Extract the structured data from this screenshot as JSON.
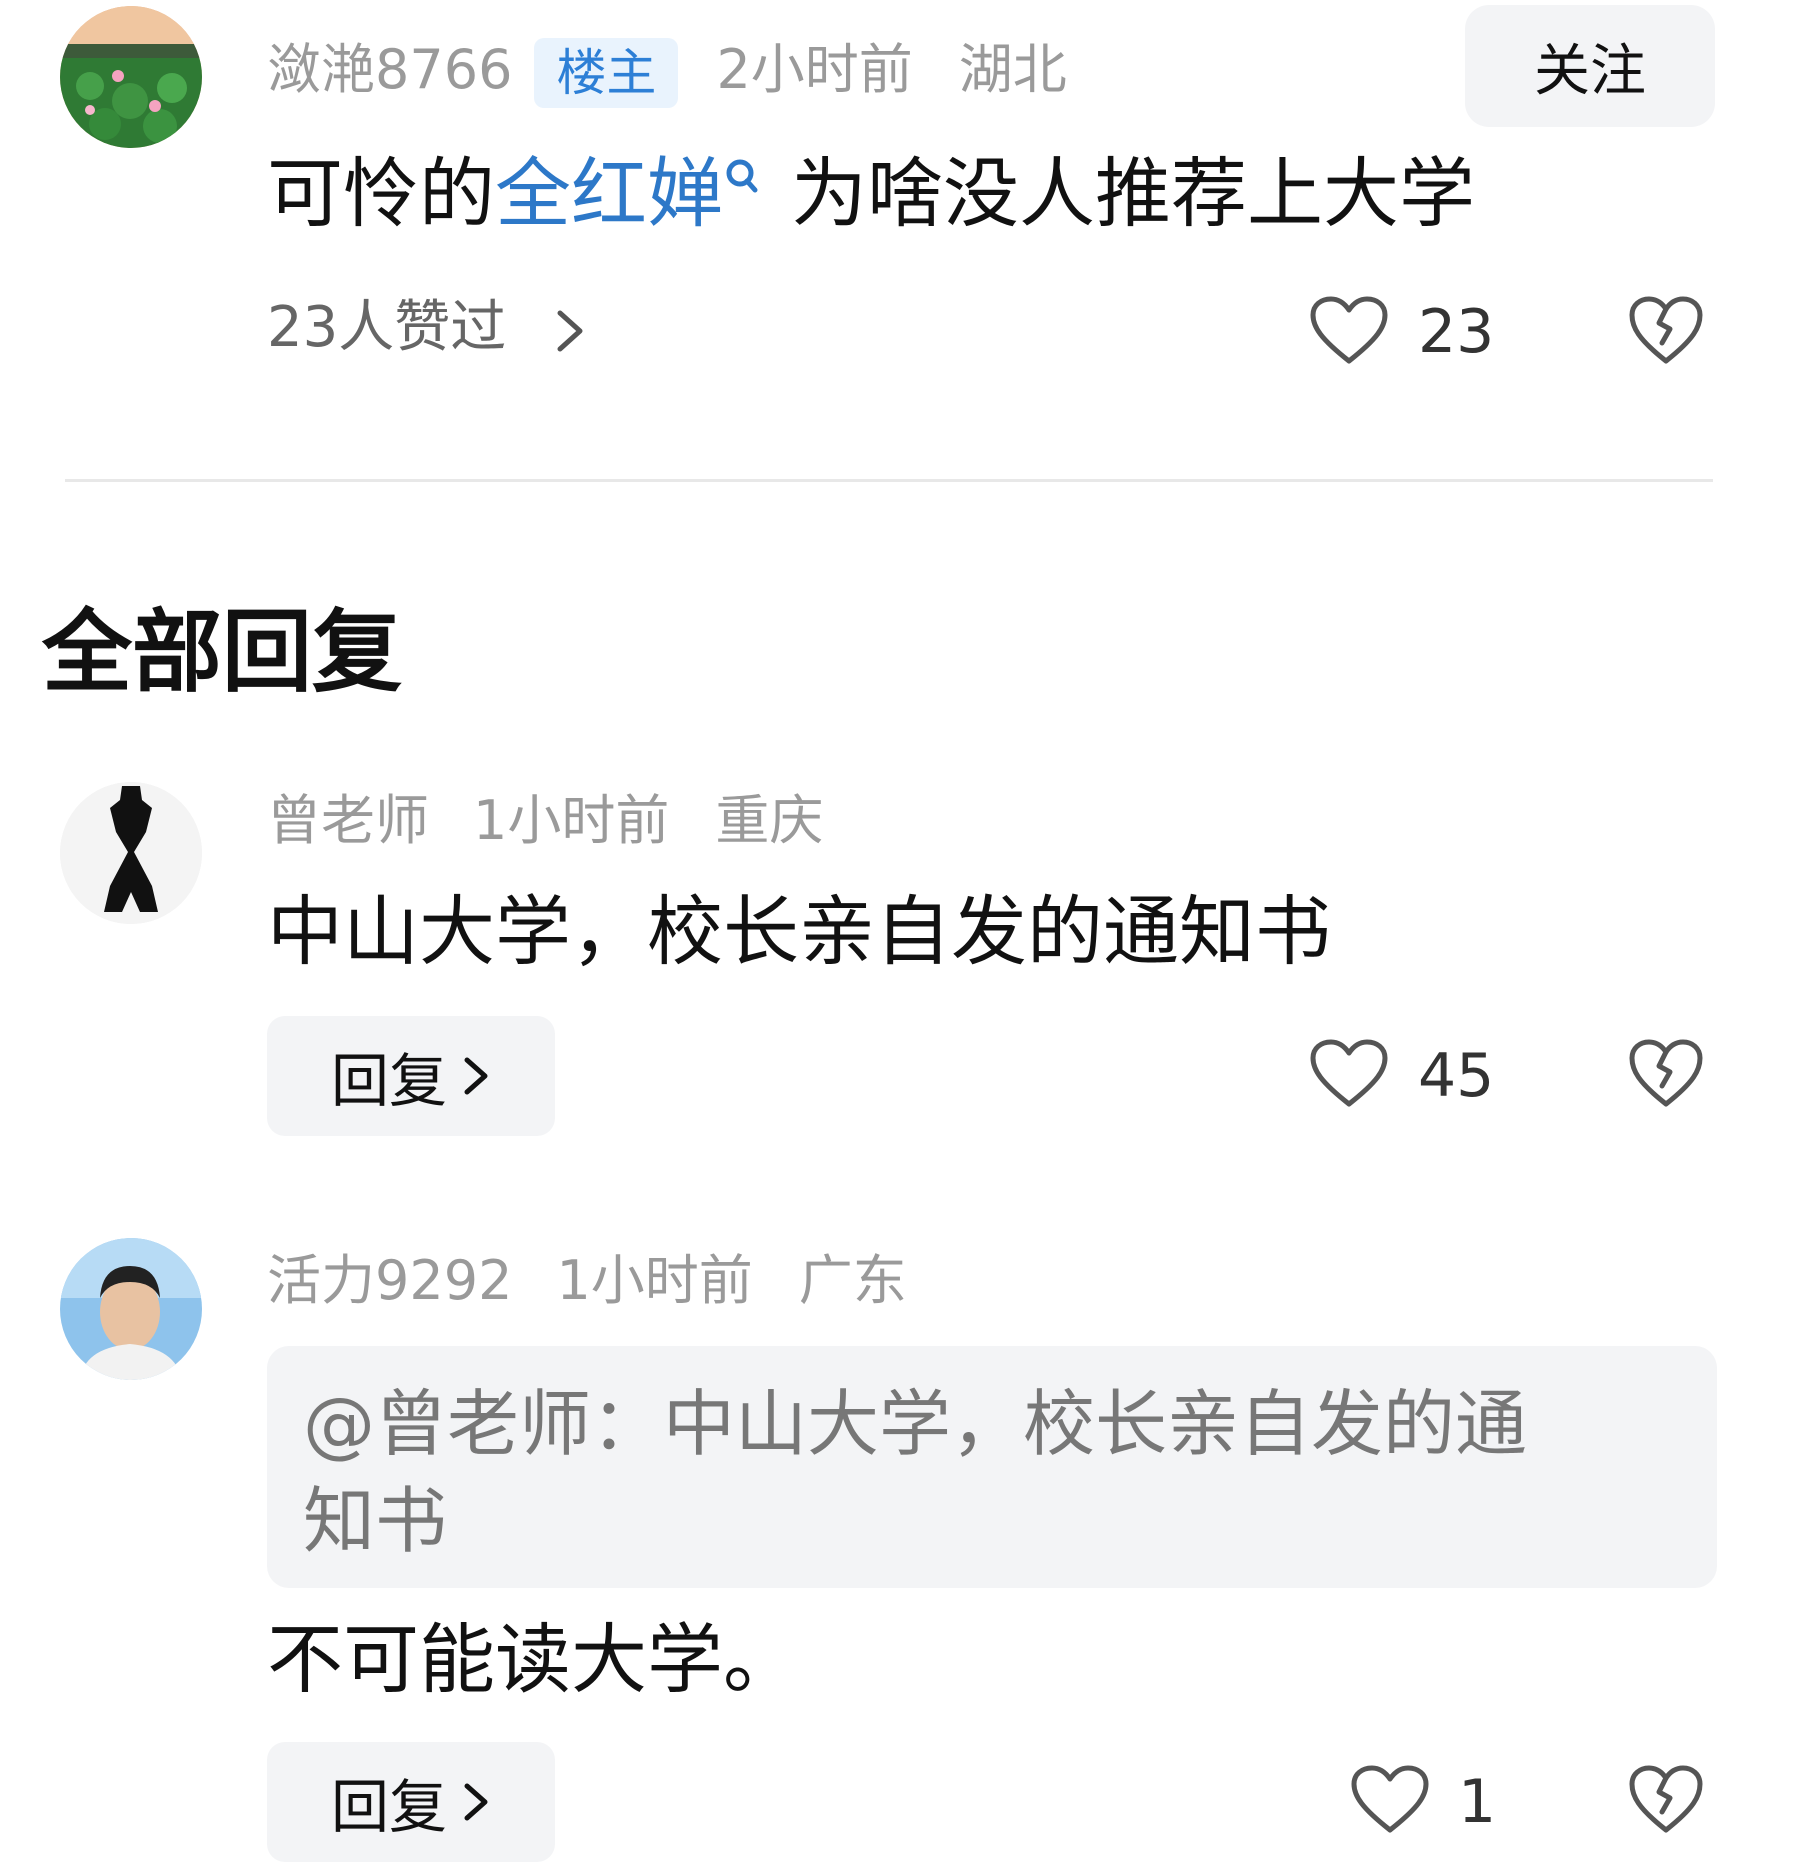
{
  "main_post": {
    "username": "潋滟8766",
    "badge": "楼主",
    "time": "2小时前",
    "location": "湖北",
    "follow_label": "关注",
    "content_prefix": "可怜的",
    "content_topic": "全红婵",
    "content_suffix": "为啥没人推荐上大学",
    "likers_text": "23人赞过",
    "like_count": "23"
  },
  "section_title": "全部回复",
  "replies": [
    {
      "username": "曾老师",
      "time": "1小时前",
      "location": "重庆",
      "content": "中山大学，校长亲自发的通知书",
      "reply_label": "回复",
      "like_count": "45"
    },
    {
      "username": "活力9292",
      "time": "1小时前",
      "location": "广东",
      "quote_line1": "@曾老师：中山大学，校长亲自发的通",
      "quote_line2": "知书",
      "content": "不可能读大学。",
      "reply_label": "回复",
      "like_count": "1"
    }
  ],
  "colors": {
    "accent": "#2d78c8",
    "badge_bg": "#e9f3fd",
    "muted_text": "#9a9a9a",
    "button_bg": "#f3f4f6"
  }
}
